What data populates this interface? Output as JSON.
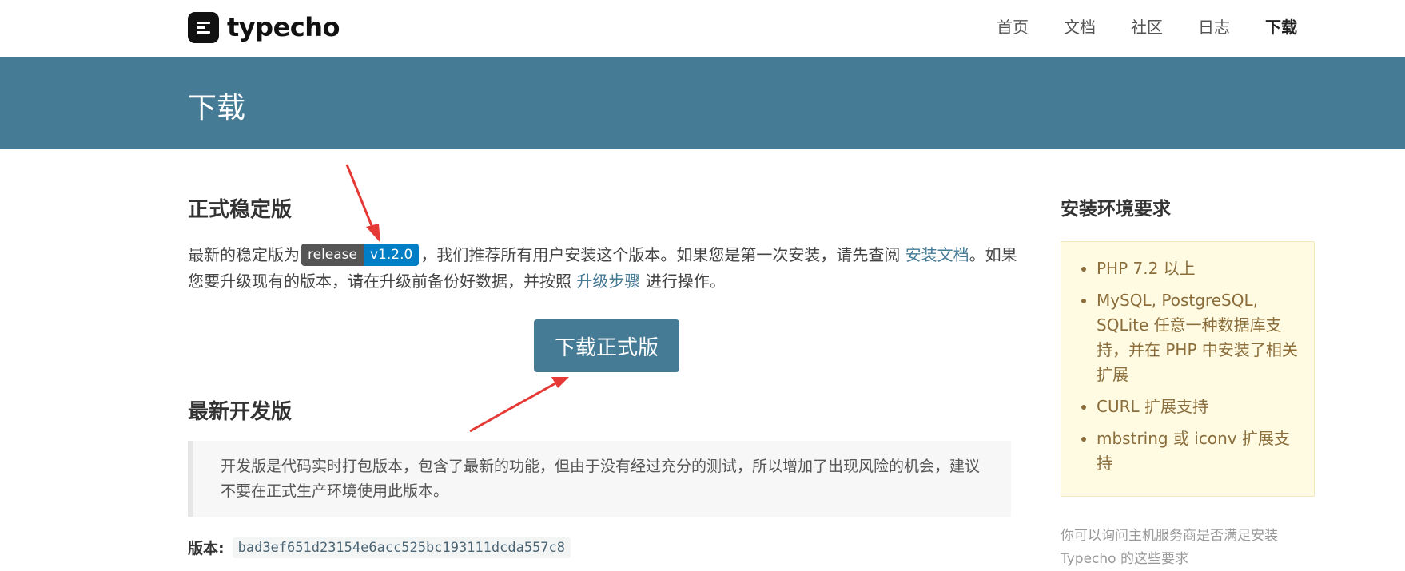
{
  "header": {
    "logo_text": "typecho",
    "nav": [
      {
        "label": "首页"
      },
      {
        "label": "文档"
      },
      {
        "label": "社区"
      },
      {
        "label": "日志"
      },
      {
        "label": "下载",
        "active": true
      }
    ]
  },
  "banner": {
    "title": "下载"
  },
  "stable": {
    "heading": "正式稳定版",
    "intro_prefix": "最新的稳定版为",
    "badge_left": "release",
    "badge_right": "v1.2.0",
    "intro_mid": "，我们推荐所有用户安装这个版本。如果您是第一次安装，请先查阅",
    "install_doc_link": "安装文档",
    "intro_line2": "。如果您要升级现有的版本，请在升级前备份好数据，并按照",
    "upgrade_link": "升级步骤",
    "intro_suffix": "进行操作。",
    "download_button": "下载正式版"
  },
  "dev": {
    "heading": "最新开发版",
    "note": "开发版是代码实时打包版本，包含了最新的功能，但由于没有经过充分的测试，所以增加了出现风险的机会，建议不要在正式生产环境使用此版本。",
    "version_label": "版本:",
    "version_hash": "bad3ef651d23154e6acc525bc193111dcda557c8"
  },
  "sidebar": {
    "heading": "安装环境要求",
    "requirements": [
      "PHP 7.2 以上",
      "MySQL, PostgreSQL, SQLite 任意一种数据库支持，并在 PHP 中安装了相关扩展",
      "CURL 扩展支持",
      "mbstring 或 iconv 扩展支持"
    ],
    "note": "你可以询问主机服务商是否满足安装 Typecho 的这些要求"
  },
  "colors": {
    "brand": "#467b96",
    "badge_left": "#555555",
    "badge_right": "#007ec6",
    "annotation_arrow": "#e53935",
    "requirement_text": "#8a6d3b",
    "requirement_bg": "#fffbe3"
  },
  "icons": {
    "logo": "typecho-logo-icon",
    "annotation": "red-arrow-annotation"
  }
}
